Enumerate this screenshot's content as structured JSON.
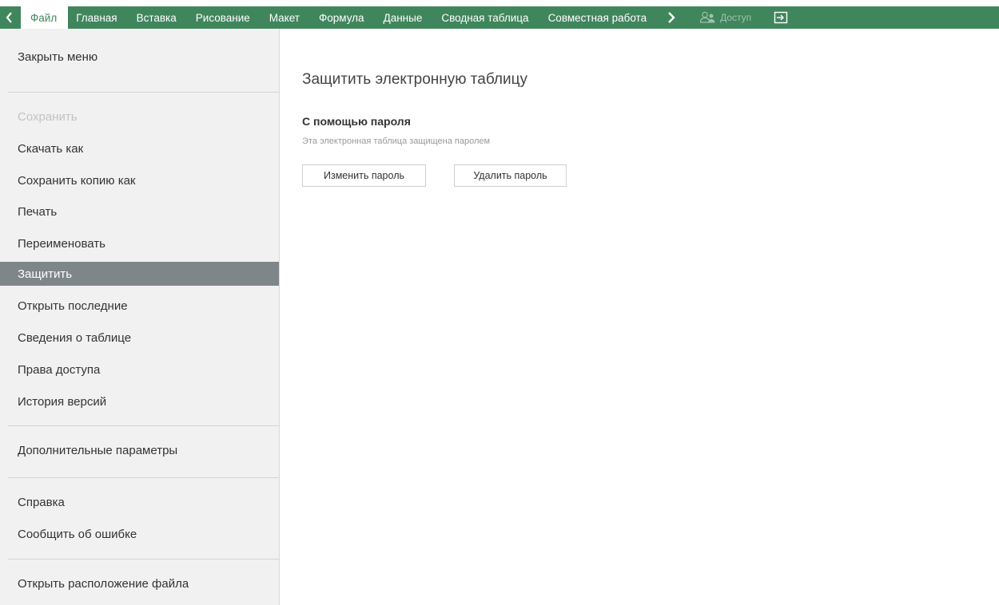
{
  "toolbar": {
    "back_icon": "chevron-left-icon",
    "tabs": [
      {
        "label": "Файл"
      },
      {
        "label": "Главная"
      },
      {
        "label": "Вставка"
      },
      {
        "label": "Рисование"
      },
      {
        "label": "Макет"
      },
      {
        "label": "Формула"
      },
      {
        "label": "Данные"
      },
      {
        "label": "Сводная таблица"
      },
      {
        "label": "Совместная работа"
      }
    ],
    "active_tab": "Файл",
    "more_icon": "chevron-right-icon",
    "access_label": "Доступ",
    "access_icon": "users-icon",
    "exit_icon": "exit-icon",
    "accent_color": "#40865c"
  },
  "file_menu": {
    "items": [
      {
        "label": "Закрыть меню"
      },
      {
        "label": "Сохранить",
        "disabled": true
      },
      {
        "label": "Скачать как"
      },
      {
        "label": "Сохранить копию как"
      },
      {
        "label": "Печать"
      },
      {
        "label": "Переименовать"
      },
      {
        "label": "Защитить",
        "selected": true
      },
      {
        "label": "Открыть последние"
      },
      {
        "label": "Сведения о таблице"
      },
      {
        "label": "Права доступа"
      },
      {
        "label": "История версий"
      },
      {
        "label": "Дополнительные параметры"
      },
      {
        "label": "Справка"
      },
      {
        "label": "Сообщить об ошибке"
      },
      {
        "label": "Открыть расположение файла"
      }
    ],
    "selected_color": "#7f868a"
  },
  "protect_panel": {
    "title": "Защитить электронную таблицу",
    "section_title": "С помощью пароля",
    "section_desc": "Эта электронная таблица защищена паролем",
    "change_password_label": "Изменить пароль",
    "delete_password_label": "Удалить пароль"
  }
}
